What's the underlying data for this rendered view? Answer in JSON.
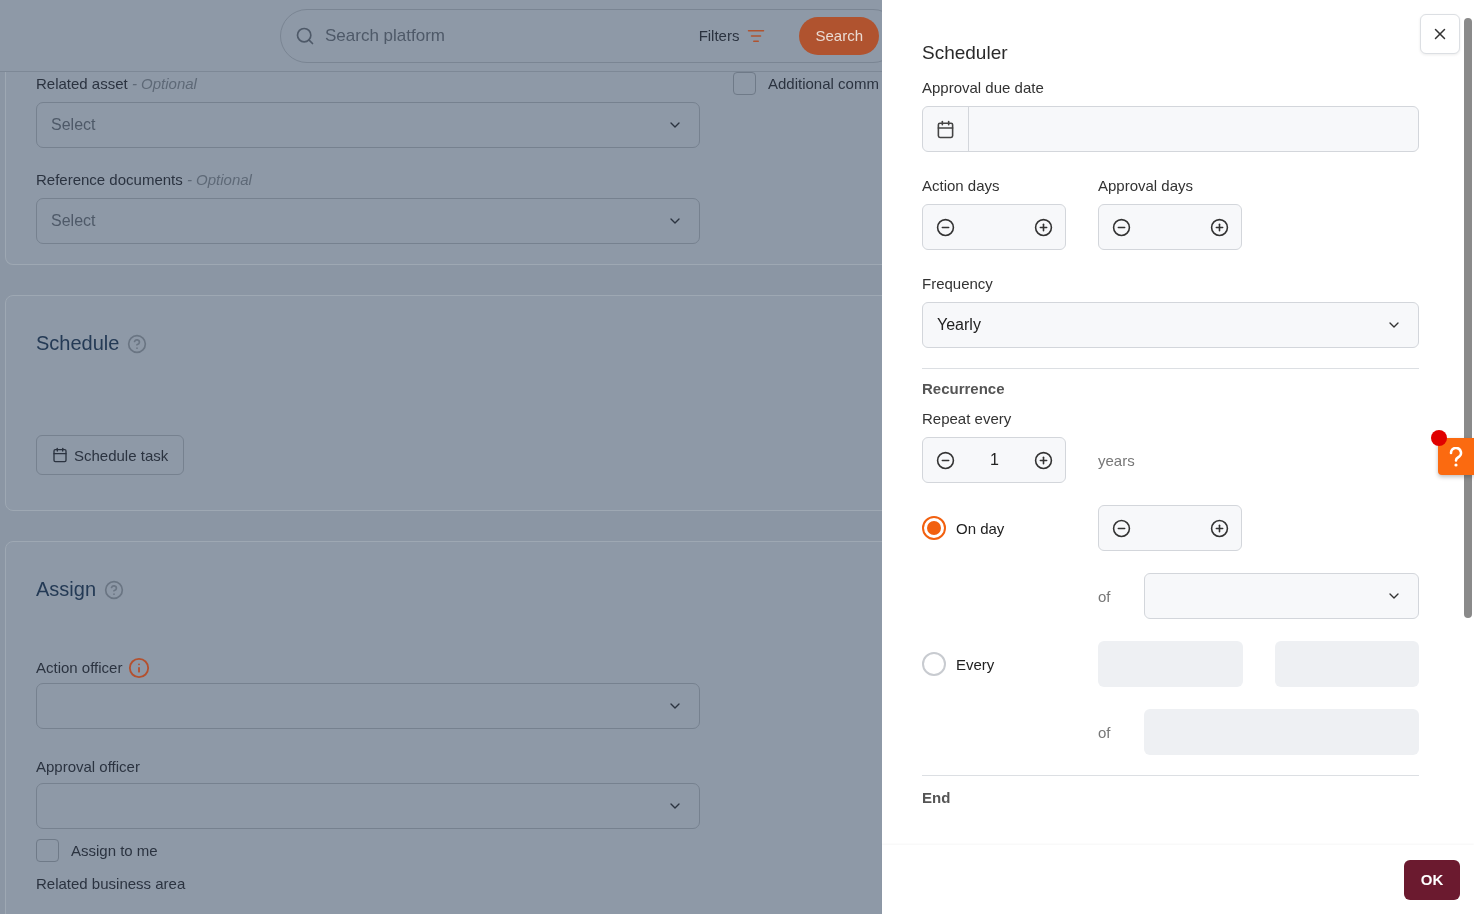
{
  "search": {
    "placeholder": "Search platform",
    "filters_label": "Filters",
    "button": "Search"
  },
  "details_card": {
    "fields": [
      {
        "label": "Related asset",
        "optional": "- Optional",
        "placeholder": "Select"
      },
      {
        "label": "Reference documents",
        "optional": "- Optional",
        "placeholder": "Select"
      }
    ],
    "checkbox": {
      "label": "Additional comm",
      "checked": false
    }
  },
  "schedule_card": {
    "title": "Schedule",
    "button": "Schedule task"
  },
  "assign_card": {
    "title": "Assign",
    "fields": [
      {
        "label": "Action officer",
        "info": true
      },
      {
        "label": "Approval officer",
        "info": false
      }
    ],
    "checkbox": {
      "label": "Assign to me",
      "checked": false
    },
    "next_label": "Related business area"
  },
  "scheduler": {
    "title": "Scheduler",
    "due_date_label": "Approval due date",
    "action_days_label": "Action days",
    "approval_days_label": "Approval days",
    "frequency_label": "Frequency",
    "frequency": "Yearly",
    "recurrence_title": "Recurrence",
    "repeat_label": "Repeat every",
    "repeat_value": "1",
    "repeat_unit": "years",
    "options": [
      {
        "label": "On day",
        "selected": true,
        "of": "of"
      },
      {
        "label": "Every",
        "selected": false,
        "of": "of"
      }
    ],
    "end_title": "End",
    "ok": "OK"
  }
}
